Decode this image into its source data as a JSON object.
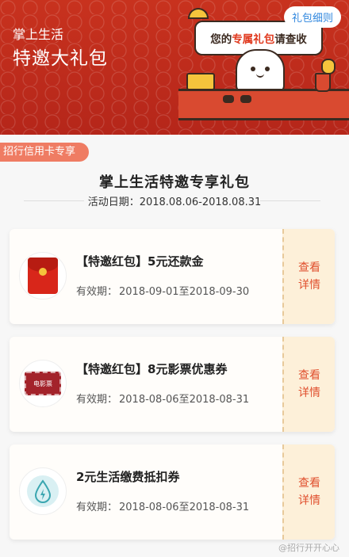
{
  "banner": {
    "subtitle": "掌上生活",
    "title": "特邀大礼包",
    "detail_link": "礼包细则",
    "speech_prefix": "您的",
    "speech_highlight": "专属礼包",
    "speech_suffix": "请查收"
  },
  "tag": "招行信用卡专享",
  "main_title": "掌上生活特邀专享礼包",
  "activity_date": "活动日期：2018.08.06-2018.08.31",
  "cards": [
    {
      "icon": "red-packet-icon",
      "name": "【特邀红包】5元还款金",
      "validity_label": "有效期：",
      "validity": "2018-09-01至2018-09-30",
      "action": "查看详情"
    },
    {
      "icon": "movie-ticket-icon",
      "icon_text": "电影票",
      "name": "【特邀红包】8元影票优惠券",
      "validity_label": "有效期：",
      "validity": "2018-08-06至2018-08-31",
      "action": "查看详情"
    },
    {
      "icon": "water-drop-icon",
      "name": "2元生活缴费抵扣券",
      "validity_label": "有效期：",
      "validity": "2018-08-06至2018-08-31",
      "action": "查看详情"
    }
  ],
  "watermark": "@招行开开心心",
  "colors": {
    "banner_red": "#c8321e",
    "action_text": "#e0502e",
    "link_blue": "#2e86de"
  }
}
